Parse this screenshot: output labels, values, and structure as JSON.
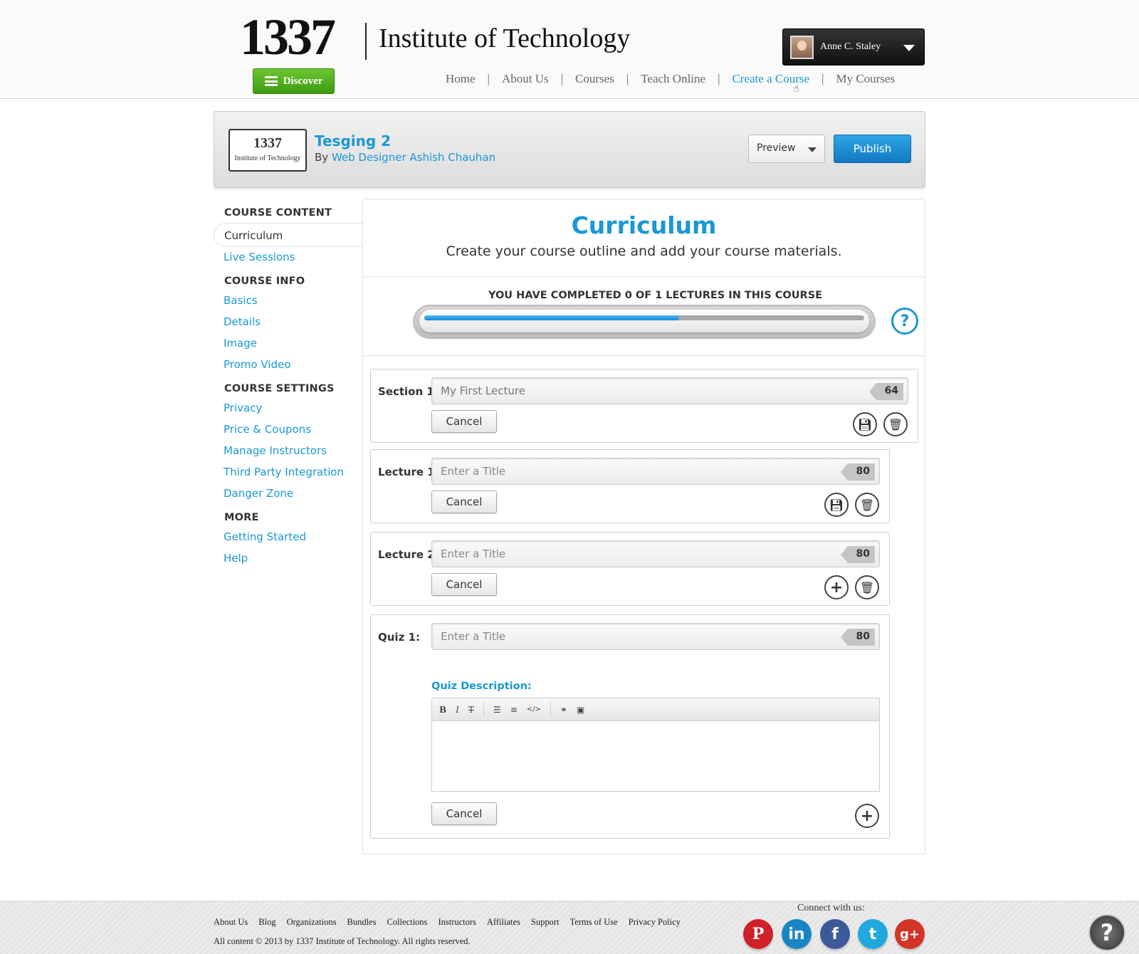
{
  "header": {
    "logo_number": "1337",
    "logo_name": "Institute of Technology",
    "discover_label": "Discover",
    "user_name": "Anne C. Staley",
    "nav": [
      "Home",
      "About Us",
      "Courses",
      "Teach Online",
      "Create a Course",
      "My Courses"
    ],
    "nav_separator": "|",
    "active_nav": "Create a Course"
  },
  "course": {
    "thumb_number": "1337",
    "thumb_name": "Institute of Technology",
    "title": "Tesging 2",
    "by_label": "By",
    "author": "Web Designer Ashish Chauhan",
    "preview_label": "Preview",
    "publish_label": "Publish"
  },
  "sidebar": {
    "groups": [
      {
        "heading": "COURSE CONTENT",
        "items": [
          "Curriculum",
          "Live Sessions"
        ]
      },
      {
        "heading": "COURSE INFO",
        "items": [
          "Basics",
          "Details",
          "Image",
          "Promo Video"
        ]
      },
      {
        "heading": "COURSE SETTINGS",
        "items": [
          "Privacy",
          "Price & Coupons",
          "Manage Instructors",
          "Third Party Integration",
          "Danger Zone"
        ]
      },
      {
        "heading": "MORE",
        "items": [
          "Getting Started",
          "Help"
        ]
      }
    ],
    "current": "Curriculum"
  },
  "main": {
    "title": "Curriculum",
    "subtitle": "Create your course outline and add your course materials.",
    "progress_text": "YOU HAVE COMPLETED 0 OF 1 LECTURES IN THIS COURSE",
    "progress_fraction": 0.58,
    "help_glyph": "?",
    "accent": "#1a98d5",
    "items": [
      {
        "label": "Section 1:",
        "value": "My First Lecture",
        "placeholder": "",
        "count": "64",
        "cancel": "Cancel",
        "buttons": [
          "save-icon",
          "trash-icon"
        ]
      },
      {
        "label": "Lecture 1:",
        "value": "",
        "placeholder": "Enter a  Title",
        "count": "80",
        "cancel": "Cancel",
        "buttons": [
          "save-icon",
          "trash-icon"
        ]
      },
      {
        "label": "Lecture 2:",
        "value": "",
        "placeholder": "Enter a  Title",
        "count": "80",
        "cancel": "Cancel",
        "buttons": [
          "plus-icon",
          "trash-icon"
        ]
      },
      {
        "label": "Quiz 1:",
        "value": "",
        "placeholder": "Enter a  Title",
        "count": "80",
        "cancel": "Cancel",
        "buttons": [
          "plus-icon"
        ],
        "description_label": "Quiz Description:"
      }
    ],
    "editor_tools": [
      "B",
      "I",
      "T",
      "list-icon",
      "numbered-list-icon",
      "</>",
      "link-icon",
      "image-icon"
    ]
  },
  "footer": {
    "links": [
      "About Us",
      "Blog",
      "Organizations",
      "Bundles",
      "Collections",
      "Instructors",
      "Affiliates",
      "Support",
      "Terms of Use",
      "Privacy Policy"
    ],
    "copyright": "All content © 2013 by 1337 Institute of Technology. All rights reserved.",
    "connect_label": "Connect with us:",
    "social": [
      {
        "name": "pinterest-icon",
        "glyph": "P",
        "color": "#d0202a"
      },
      {
        "name": "linkedin-icon",
        "glyph": "in",
        "color": "#1a85c4"
      },
      {
        "name": "facebook-icon",
        "glyph": "f",
        "color": "#3b5a9a"
      },
      {
        "name": "twitter-icon",
        "glyph": "t",
        "color": "#21a8df"
      },
      {
        "name": "googleplus-icon",
        "glyph": "g+",
        "color": "#d33428"
      }
    ],
    "help_glyph": "?"
  }
}
